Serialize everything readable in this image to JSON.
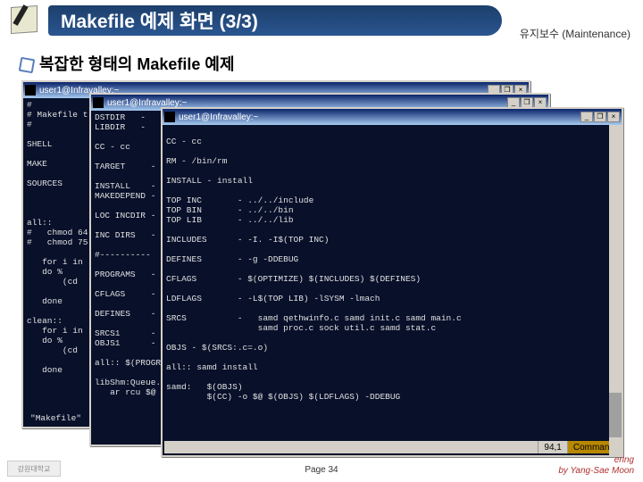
{
  "header": {
    "title": "Makefile 예제 화면 (3/3)",
    "sub": "유지보수 (Maintenance)"
  },
  "content": {
    "title": "복잡한 형태의 Makefile 예제"
  },
  "terminals": {
    "tb_label": "user1@Infravalley:~",
    "btn_min": "_",
    "btn_max": "❐",
    "btn_close": "×",
    "win1_body": "#\n# Makefile t\n#\n\nSHELL\n\nMAKE\n\nSOURCES\n\n\n\nall::\n#   chmod 64\n#   chmod 75\n\n   for i in\n   do %\n       (cd\n\n   done\n\nclean::\n   for i in\n   do %\n       (cd\n\n   done",
    "win1_foot": "\"Makefile\"",
    "win2_body": "DSTDIR   -\nLIBDIR   -\n\nCC - cc\n\nTARGET     - s\n\nINSTALL    - /\nMAKEDEPEND - m\n\nLOC INCDIR -\n\nINC DIRS   - -\n\n#----------\n\nPROGRAMS   - l\n\nCFLAGS     - $\n\nDEFINES    - -\n\nSRCS1      - s\nOBJS1      - l\n\nall:: $(PROGRA\n\nlibShm:Queue.a:\n   ar rcu $@ $",
    "win3_body": "\nCC - cc\n\nRM - /bin/rm\n\nINSTALL - install\n\nTOP INC       - ../../include\nTOP BIN       - ../../bin\nTOP LIB       - ../../lib\n\nINCLUDES      - -I. -I$(TOP INC)\n\nDEFINES       - -g -DDEBUG\n\nCFLAGS        - $(OPTIMIZE) $(INCLUDES) $(DEFINES)\n\nLDFLAGS       - -L$(TOP LIB) -lSYSM -lmach\n\nSRCS          -   samd qethwinfo.c samd init.c samd main.c\n                  samd proc.c sock util.c samd stat.c\n\nOBJS - $(SRCS:.c=.o)\n\nall:: samd install\n\nsamd:   $(OBJS)\n        $(CC) -o $@ $(OBJS) $(LDFLAGS) -DDEBUG",
    "win3_status_pos": "94,1",
    "win3_status_mode": "Command"
  },
  "footer": {
    "page": "Page 34",
    "right1": "ering",
    "right2": "by Yang-Sae Moon",
    "logo": "강원대학교"
  }
}
